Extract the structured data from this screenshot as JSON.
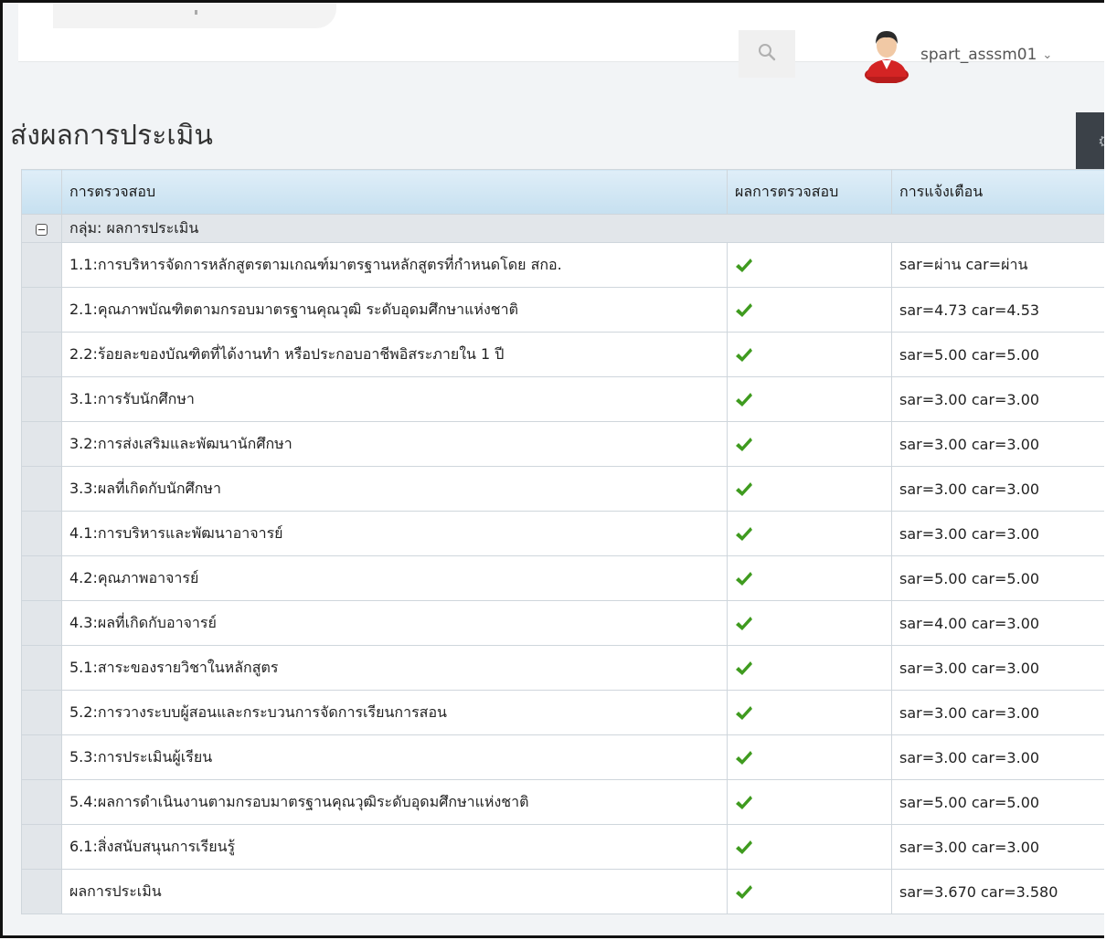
{
  "header": {
    "username": "spart_asssm01",
    "search_icon": "search-icon",
    "avatar_icon": "user-avatar-icon"
  },
  "page": {
    "title": "ส่งผลการประเมิน"
  },
  "table": {
    "columns": [
      "การตรวจสอบ",
      "ผลการตรวจสอบ",
      "การแจ้งเตือน"
    ],
    "group_label": "กลุ่ม: ผลการประเมิน",
    "rows": [
      {
        "check": "1.1:การบริหารจัดการหลักสูตรตามเกณฑ์มาตรฐานหลักสูตรที่กำหนดโดย สกอ.",
        "alert": "sar=ผ่าน car=ผ่าน"
      },
      {
        "check": "2.1:คุณภาพบัณฑิตตามกรอบมาตรฐานคุณวุฒิ ระดับอุดมศึกษาแห่งชาติ",
        "alert": "sar=4.73 car=4.53"
      },
      {
        "check": "2.2:ร้อยละของบัณฑิตที่ได้งานทำ หรือประกอบอาชีพอิสระภายใน 1 ปี",
        "alert": "sar=5.00 car=5.00"
      },
      {
        "check": "3.1:การรับนักศึกษา",
        "alert": "sar=3.00 car=3.00"
      },
      {
        "check": "3.2:การส่งเสริมและพัฒนานักศึกษา",
        "alert": "sar=3.00 car=3.00"
      },
      {
        "check": "3.3:ผลที่เกิดกับนักศึกษา",
        "alert": "sar=3.00 car=3.00"
      },
      {
        "check": "4.1:การบริหารและพัฒนาอาจารย์",
        "alert": "sar=3.00 car=3.00"
      },
      {
        "check": "4.2:คุณภาพอาจารย์",
        "alert": "sar=5.00 car=5.00"
      },
      {
        "check": "4.3:ผลที่เกิดกับอาจารย์",
        "alert": "sar=4.00 car=3.00"
      },
      {
        "check": "5.1:สาระของรายวิชาในหลักสูตร",
        "alert": "sar=3.00 car=3.00"
      },
      {
        "check": "5.2:การวางระบบผู้สอนและกระบวนการจัดการเรียนการสอน",
        "alert": "sar=3.00 car=3.00"
      },
      {
        "check": "5.3:การประเมินผู้เรียน",
        "alert": "sar=3.00 car=3.00"
      },
      {
        "check": "5.4:ผลการดำเนินงานตามกรอบมาตรฐานคุณวุฒิระดับอุดมศึกษาแห่งชาติ",
        "alert": "sar=5.00 car=5.00"
      },
      {
        "check": "6.1:สิ่งสนับสนุนการเรียนรู้",
        "alert": "sar=3.00 car=3.00"
      },
      {
        "check": "ผลการประเมิน",
        "alert": "sar=3.670 car=3.580"
      }
    ],
    "result_icon": "check-icon",
    "result_color": "#3f9b1f"
  },
  "colors": {
    "header_gradient_top": "#dfeef8",
    "header_gradient_bottom": "#c6e0f0",
    "group_row": "#e2e6ea",
    "settings_tab": "#3b4148"
  }
}
